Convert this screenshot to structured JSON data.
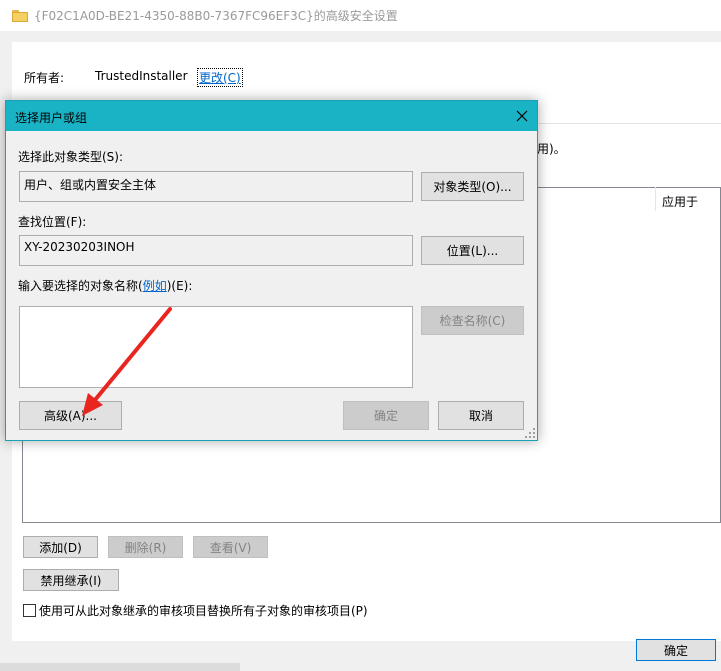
{
  "window": {
    "title": "{F02C1A0D-BE21-4350-88B0-7367FC96EF3C}的高级安全设置",
    "owner_label": "所有者:",
    "owner_value": "TrustedInstaller",
    "change_link": "更改(C)",
    "hint_tail": "用)。",
    "column_apply_to": "应用于",
    "buttons": {
      "add": "添加(D)",
      "remove": "删除(R)",
      "view": "查看(V)",
      "disable_inheritance": "禁用继承(I)",
      "ok": "确定"
    },
    "replace_checkbox_label": "使用可从此对象继承的审核项目替换所有子对象的审核项目(P)"
  },
  "dialog": {
    "title": "选择用户或组",
    "object_type_label": "选择此对象类型(S):",
    "object_type_value": "用户、组或内置安全主体",
    "object_type_button": "对象类型(O)...",
    "location_label": "查找位置(F):",
    "location_value": "XY-20230203INOH",
    "location_button": "位置(L)...",
    "enter_name_prefix": "输入要选择的对象名称(",
    "enter_name_link": "例如",
    "enter_name_suffix": ")(E):",
    "check_names_button": "检查名称(C)",
    "advanced_button": "高级(A)...",
    "ok_button": "确定",
    "cancel_button": "取消"
  },
  "colors": {
    "dialog_titlebar": "#1ab3c5",
    "annotation_arrow": "#e8251f",
    "link": "#0066cc"
  }
}
